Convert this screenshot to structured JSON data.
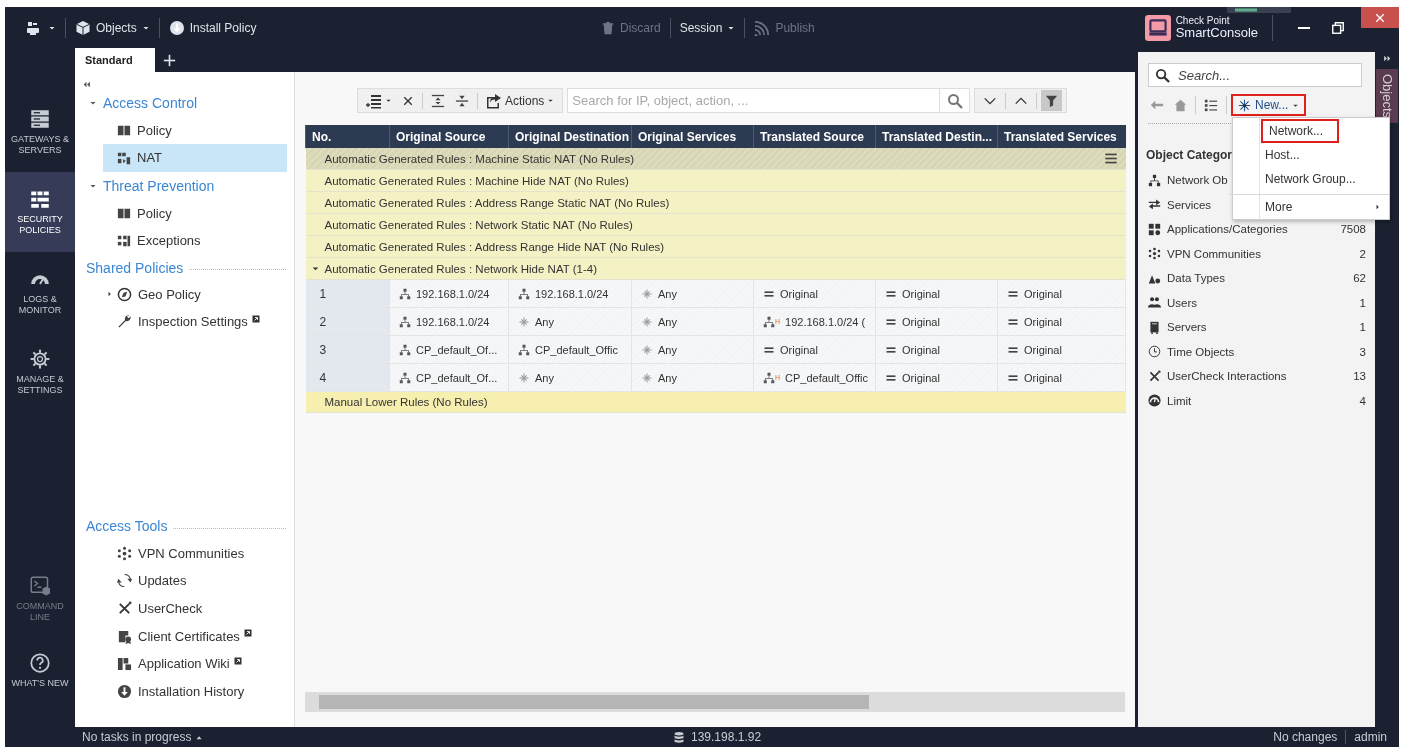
{
  "topbar": {
    "objects": "Objects",
    "install": "Install Policy",
    "discard": {
      "label": "Discard",
      "disabled": true
    },
    "session": "Session",
    "publish": {
      "label": "Publish",
      "disabled": true
    },
    "brand_top": "Check Point",
    "brand_bottom": "Smart**Console**"
  },
  "nav": {
    "top": [
      {
        "label": "GATEWAYS & SERVERS",
        "selected": false,
        "disabled": false
      },
      {
        "label": "SECURITY POLICIES",
        "selected": true,
        "disabled": false
      },
      {
        "label": "LOGS & MONITOR",
        "selected": false,
        "disabled": false
      },
      {
        "label": "MANAGE & SETTINGS",
        "selected": false,
        "disabled": false
      }
    ],
    "bottom": [
      {
        "label": "COMMAND LINE",
        "selected": false,
        "disabled": true
      },
      {
        "label": "WHAT'S NEW",
        "selected": false,
        "disabled": false
      }
    ]
  },
  "tabs": [
    {
      "label": "Standard",
      "selected": true
    }
  ],
  "tree": {
    "groups": [
      {
        "kind": "tree",
        "items": [
          {
            "label": "Access Control",
            "expanded": true,
            "children": [
              {
                "label": "Policy",
                "selected": false
              },
              {
                "label": "NAT",
                "selected": true
              }
            ]
          },
          {
            "label": "Threat Prevention",
            "expanded": true,
            "children": [
              {
                "label": "Policy",
                "selected": false
              },
              {
                "label": "Exceptions",
                "selected": false
              }
            ]
          }
        ]
      },
      {
        "kind": "list",
        "title": "Shared Policies",
        "items": [
          {
            "label": "Geo Policy",
            "expanded": false,
            "selected": false,
            "external": false
          },
          {
            "label": "Inspection Settings",
            "selected": false,
            "external": true
          }
        ]
      },
      {
        "kind": "list",
        "title": "Access Tools",
        "items": [
          {
            "label": "VPN Communities",
            "selected": false,
            "external": false
          },
          {
            "label": "Updates",
            "selected": false,
            "external": false
          },
          {
            "label": "UserCheck",
            "selected": false,
            "external": false
          },
          {
            "label": "Client Certificates",
            "selected": false,
            "external": true
          },
          {
            "label": "Application Wiki",
            "selected": false,
            "external": true
          },
          {
            "label": "Installation History",
            "selected": false,
            "external": false
          }
        ]
      }
    ]
  },
  "rules": {
    "toolbar": {
      "actions": "Actions",
      "search_placeholder": "Search for IP, object, action, ...",
      "filter_on": true
    },
    "columns": [
      "No.",
      "Original Source",
      "Original Destination",
      "Original Services",
      "Translated Source",
      "Translated Destin...",
      "Translated Services"
    ],
    "rows": [
      {
        "kind": "group",
        "label": "Automatic Generated Rules : Machine Static NAT (No Rules)",
        "selected": true
      },
      {
        "kind": "group",
        "label": "Automatic Generated Rules : Machine Hide NAT (No Rules)",
        "selected": false
      },
      {
        "kind": "group",
        "label": "Automatic Generated Rules : Address Range Static NAT (No Rules)",
        "selected": false
      },
      {
        "kind": "group",
        "label": "Automatic Generated Rules : Network Static NAT (No Rules)",
        "selected": false
      },
      {
        "kind": "group",
        "label": "Automatic Generated Rules : Address Range Hide NAT (No Rules)",
        "selected": false
      },
      {
        "kind": "group",
        "label": "Automatic Generated Rules : Network Hide NAT (1-4)",
        "selected": false,
        "expanded": true
      },
      {
        "kind": "rule",
        "no": "1",
        "selected": false,
        "cells": [
          {
            "kind": "network",
            "text": "192.168.1.0/24"
          },
          {
            "kind": "network",
            "text": "192.168.1.0/24"
          },
          {
            "kind": "any",
            "text": "Any"
          },
          {
            "kind": "original",
            "text": "Original"
          },
          {
            "kind": "original",
            "text": "Original"
          },
          {
            "kind": "original",
            "text": "Original"
          }
        ]
      },
      {
        "kind": "rule",
        "no": "2",
        "selected": false,
        "cells": [
          {
            "kind": "network",
            "text": "192.168.1.0/24"
          },
          {
            "kind": "any",
            "text": "Any"
          },
          {
            "kind": "any",
            "text": "Any"
          },
          {
            "kind": "hide",
            "badge": "H",
            "text": "192.168.1.0/24 ("
          },
          {
            "kind": "original",
            "text": "Original"
          },
          {
            "kind": "original",
            "text": "Original"
          }
        ]
      },
      {
        "kind": "rule",
        "no": "3",
        "selected": false,
        "cells": [
          {
            "kind": "network",
            "text": "CP_default_Of..."
          },
          {
            "kind": "network",
            "text": "CP_default_Offic"
          },
          {
            "kind": "any",
            "text": "Any"
          },
          {
            "kind": "original",
            "text": "Original"
          },
          {
            "kind": "original",
            "text": "Original"
          },
          {
            "kind": "original",
            "text": "Original"
          }
        ]
      },
      {
        "kind": "rule",
        "no": "4",
        "selected": false,
        "cells": [
          {
            "kind": "network",
            "text": "CP_default_Of..."
          },
          {
            "kind": "any",
            "text": "Any"
          },
          {
            "kind": "any",
            "text": "Any"
          },
          {
            "kind": "hide",
            "badge": "H",
            "text": "CP_default_Offic"
          },
          {
            "kind": "original",
            "text": "Original"
          },
          {
            "kind": "original",
            "text": "Original"
          }
        ]
      },
      {
        "kind": "manual",
        "label": "Manual Lower Rules (No Rules)",
        "selected": false
      }
    ]
  },
  "objects": {
    "search_placeholder": "Search...",
    "new_label": "New...",
    "new_highlighted": true,
    "menu": [
      {
        "label": "Network...",
        "highlighted": true,
        "separator_before": false,
        "submenu": false
      },
      {
        "label": "Host...",
        "highlighted": false,
        "separator_before": false,
        "submenu": false
      },
      {
        "label": "Network Group...",
        "highlighted": false,
        "separator_before": false,
        "submenu": false
      },
      {
        "label": "More",
        "highlighted": false,
        "separator_before": true,
        "submenu": true
      }
    ],
    "categories_title": "Object Categor",
    "categories": [
      {
        "label": "Network Ob"
      },
      {
        "label": "Services"
      },
      {
        "label": "Applications/Categories",
        "count": "7508"
      },
      {
        "label": "VPN Communities",
        "count": "2"
      },
      {
        "label": "Data Types",
        "count": "62"
      },
      {
        "label": "Users",
        "count": "1"
      },
      {
        "label": "Servers",
        "count": "1"
      },
      {
        "label": "Time Objects",
        "count": "3"
      },
      {
        "label": "UserCheck Interactions",
        "count": "13"
      },
      {
        "label": "Limit",
        "count": "4"
      }
    ],
    "side_tab": "Objects"
  },
  "status": {
    "tasks": "No tasks in progress",
    "server": "139.198.1.92",
    "changes": "No changes",
    "user": "admin"
  }
}
